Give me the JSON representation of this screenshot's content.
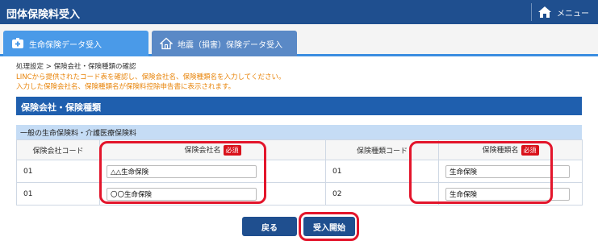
{
  "app": {
    "title": "団体保険料受入",
    "menu_label": "メニュー"
  },
  "tabs": [
    {
      "label": "生命保険データ受入",
      "active": true
    },
    {
      "label": "地震（損害）保険データ受入",
      "active": false
    }
  ],
  "breadcrumb": "処理設定 > 保険会社・保険種類の確認",
  "notices": [
    "LINCから提供されたコード表を確認し、保険会社名、保険種類名を入力してください。",
    "入力した保険会社名、保険種類名が保険料控除申告書に表示されます。"
  ],
  "section_title": "保険会社・保険種類",
  "subsection_title": "一般の生命保険料・介護医療保険料",
  "table": {
    "headers": {
      "company_code": "保険会社コード",
      "company_name": "保険会社名",
      "type_code": "保険種類コード",
      "type_name": "保険種類名",
      "required": "必須"
    },
    "rows": [
      {
        "company_code": "01",
        "company_name": "△△生命保険",
        "type_code": "01",
        "type_name": "生命保険"
      },
      {
        "company_code": "01",
        "company_name": "〇〇生命保険",
        "type_code": "02",
        "type_name": "生命保険"
      }
    ]
  },
  "buttons": {
    "back": "戻る",
    "start": "受入開始"
  },
  "colors": {
    "header": "#1f4f8f",
    "accent": "#4a9ae8",
    "notice": "#e8840a",
    "required": "#d9121b",
    "highlight": "#e3152b"
  },
  "icons": {
    "home": "home-icon",
    "tab1": "medical-cross-icon",
    "tab2": "house-icon"
  }
}
